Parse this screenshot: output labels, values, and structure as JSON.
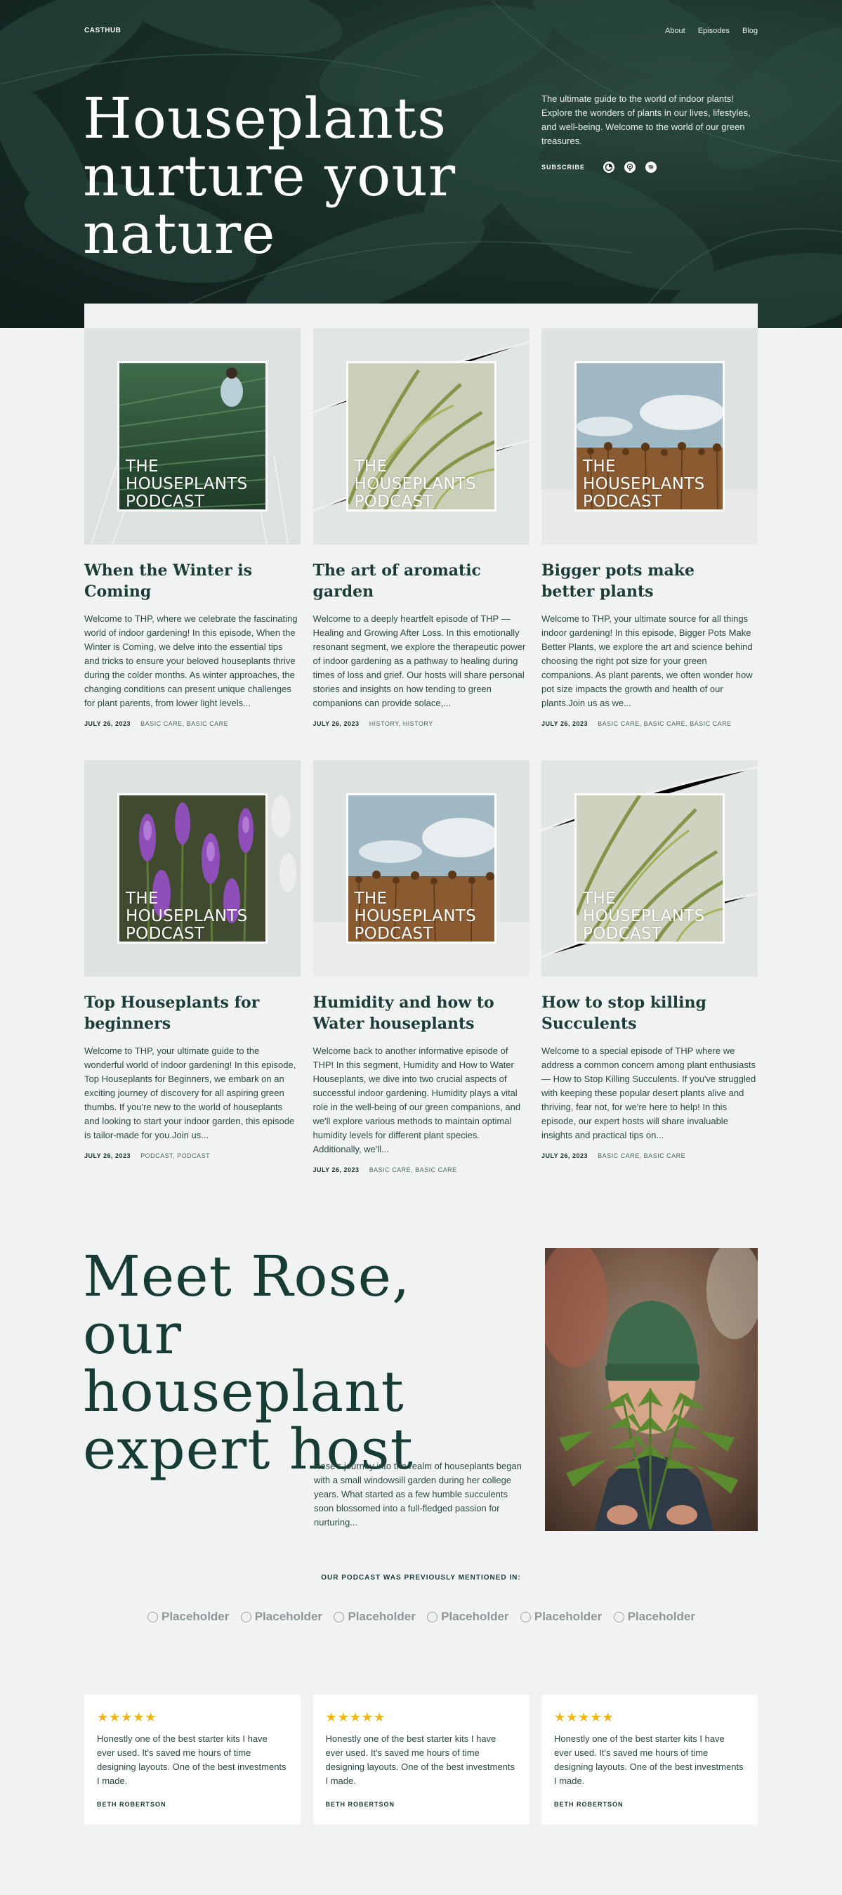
{
  "header": {
    "brand": "CASTHUB",
    "nav": [
      "About",
      "Episodes",
      "Blog"
    ]
  },
  "hero": {
    "title": "Houseplants nurture your nature",
    "description": "The ultimate guide to the world of indoor plants! Explore the wonders of plants in our lives, lifestyles, and well-being. Welcome to the world of our green treasures.",
    "subscribe_label": "SUBSCRIBE",
    "subscribe_icons": [
      "podcast-app-icon",
      "podcast-mic-icon",
      "spotify-icon"
    ]
  },
  "episodes": [
    {
      "cover_title": "THE HOUSEPLANTS PODCAST",
      "title": "When the Winter is Coming",
      "excerpt": "Welcome to THP, where we celebrate the fascinating world of indoor gardening! In this episode, When the Winter is Coming, we delve into the essential tips and tricks to ensure your beloved houseplants thrive during the colder months. As winter approaches, the changing conditions can present unique challenges for plant parents, from lower light levels...",
      "date": "JULY 26, 2023",
      "tags": "BASIC CARE, BASIC CARE"
    },
    {
      "cover_title": "THE HOUSEPLANTS PODCAST",
      "title": "The art of aromatic garden",
      "excerpt": "Welcome to a deeply heartfelt episode of THP — Healing and Growing After Loss. In this emotionally resonant segment, we explore the therapeutic power of indoor gardening as a pathway to healing during times of loss and grief. Our hosts will share personal stories and insights on how tending to green companions can provide solace,...",
      "date": "JULY 26, 2023",
      "tags": "HISTORY, HISTORY"
    },
    {
      "cover_title": "THE HOUSEPLANTS PODCAST",
      "title": "Bigger pots make better plants",
      "excerpt": "Welcome to THP, your ultimate source for all things indoor gardening! In this episode, Bigger Pots Make Better Plants, we explore the art and science behind choosing the right pot size for your green companions. As plant parents, we often wonder how pot size impacts the growth and health of our plants.Join us as we...",
      "date": "JULY 26, 2023",
      "tags": "BASIC CARE, BASIC CARE, BASIC CARE"
    },
    {
      "cover_title": "THE HOUSEPLANTS PODCAST",
      "title": "Top Houseplants for beginners",
      "excerpt": "Welcome to THP, your ultimate guide to the wonderful world of indoor gardening! In this episode, Top Houseplants for Beginners, we embark on an exciting journey of discovery for all aspiring green thumbs. If you're new to the world of houseplants and looking to start your indoor garden, this episode is tailor-made for you.Join us...",
      "date": "JULY 26, 2023",
      "tags": "PODCAST, PODCAST"
    },
    {
      "cover_title": "THE HOUSEPLANTS PODCAST",
      "title": "Humidity and how to Water houseplants",
      "excerpt": "Welcome back to another informative episode of THP! In this segment, Humidity and How to Water Houseplants, we dive into two crucial aspects of successful indoor gardening. Humidity plays a vital role in the well-being of our green companions, and we'll explore various methods to maintain optimal humidity levels for different plant species. Additionally, we'll...",
      "date": "JULY 26, 2023",
      "tags": "BASIC CARE, BASIC CARE"
    },
    {
      "cover_title": "THE HOUSEPLANTS PODCAST",
      "title": "How to stop killing Succulents",
      "excerpt": "Welcome to a special episode of THP where we address a common concern among plant enthusiasts — How to Stop Killing Succulents. If you've struggled with keeping these popular desert plants alive and thriving, fear not, for we're here to help! In this episode, our expert hosts will share invaluable insights and practical tips on...",
      "date": "JULY 26, 2023",
      "tags": "BASIC CARE, BASIC CARE"
    }
  ],
  "host": {
    "title": "Meet Rose, our houseplant expert host",
    "text": "Rose's journey into the realm of houseplants began with a small windowsill garden during her college years. What started as a few humble succulents soon blossomed into a full-fledged passion for nurturing..."
  },
  "mentions": {
    "heading": "OUR PODCAST WAS PREVIOUSLY MENTIONED IN:",
    "logos": [
      "Placeholder",
      "Placeholder",
      "Placeholder",
      "Placeholder",
      "Placeholder",
      "Placeholder"
    ]
  },
  "reviews": [
    {
      "stars": "★★★★★",
      "text": "Honestly one of the best starter kits I have ever used. It's saved me hours of time designing layouts. One of the best investments I made.",
      "author": "BETH ROBERTSON"
    },
    {
      "stars": "★★★★★",
      "text": "Honestly one of the best starter kits I have ever used. It's saved me hours of time designing layouts. One of the best investments I made.",
      "author": "BETH ROBERTSON"
    },
    {
      "stars": "★★★★★",
      "text": "Honestly one of the best starter kits I have ever used. It's saved me hours of time designing layouts. One of the best investments I made.",
      "author": "BETH ROBERTSON"
    }
  ],
  "colors": {
    "hero_bg": "#1a2f2a",
    "page_bg": "#f1f3f2",
    "heading": "#173c33",
    "star": "#f3b21a"
  }
}
